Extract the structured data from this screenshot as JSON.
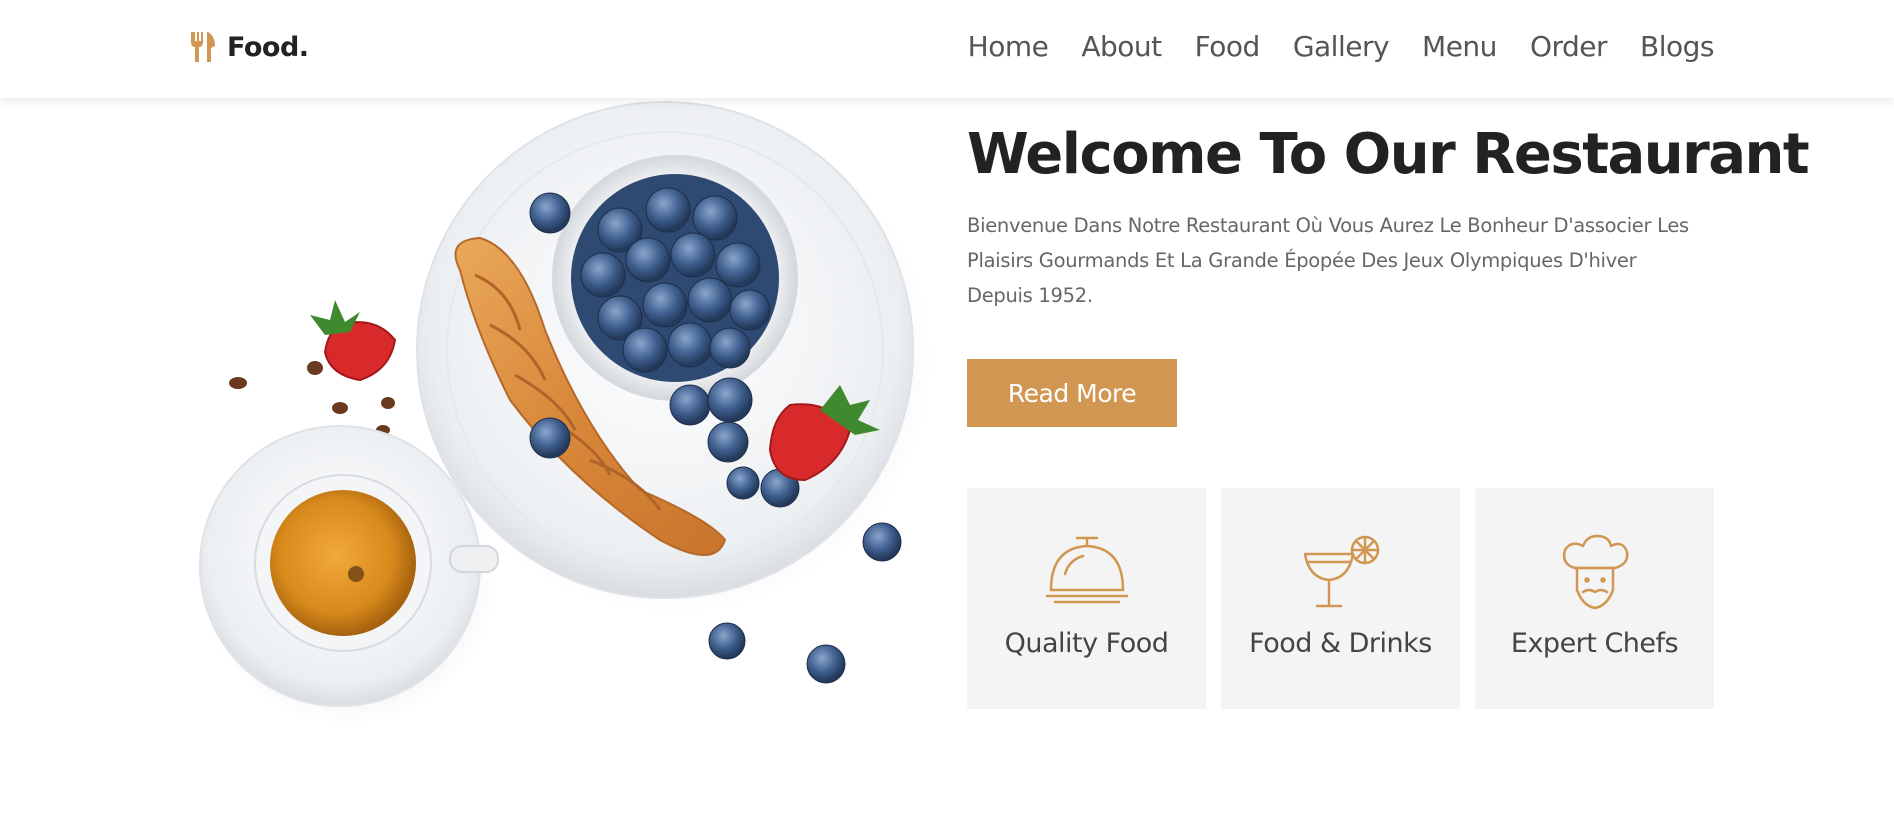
{
  "logo": {
    "icon": "fork-knife-icon",
    "text": "Food."
  },
  "nav": {
    "items": [
      "Home",
      "About",
      "Food",
      "Gallery",
      "Menu",
      "Order",
      "Blogs"
    ]
  },
  "hero": {
    "title": "Welcome To Our Restaurant",
    "description": "Bienvenue Dans Notre Restaurant Où Vous Aurez Le Bonheur D'associer Les Plaisirs Gourmands Et La Grande Épopée Des Jeux Olympiques D'hiver Depuis 1952.",
    "button_label": "Read More"
  },
  "features": [
    {
      "icon": "cloche-icon",
      "label": "Quality Food"
    },
    {
      "icon": "cocktail-icon",
      "label": "Food & Drinks"
    },
    {
      "icon": "chef-icon",
      "label": "Expert Chefs"
    }
  ],
  "colors": {
    "accent": "#d19752",
    "card_bg": "#f4f4f4",
    "text_dark": "#222222",
    "text_muted": "#666666"
  }
}
